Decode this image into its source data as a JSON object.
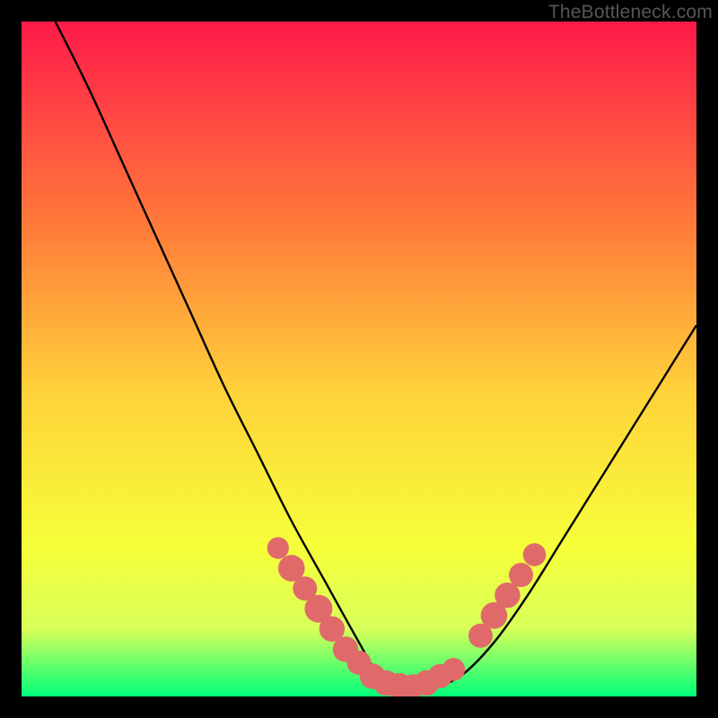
{
  "watermark": "TheBottleneck.com",
  "colors": {
    "gradient_top": "#ff1a4a",
    "gradient_mid_upper": "#ff7a3a",
    "gradient_mid": "#ffd23a",
    "gradient_mid_lower": "#f6ff3a",
    "gradient_lower": "#d8ff5a",
    "gradient_bottom": "#00ff7a",
    "curve": "#000000",
    "markers": "#e06a6a",
    "frame": "#000000"
  },
  "chart_data": {
    "type": "line",
    "title": "",
    "xlabel": "",
    "ylabel": "",
    "xlim": [
      0,
      100
    ],
    "ylim": [
      0,
      100
    ],
    "series": [
      {
        "name": "bottleneck-curve",
        "x": [
          5,
          10,
          15,
          20,
          25,
          30,
          35,
          40,
          45,
          50,
          53,
          56,
          60,
          65,
          70,
          75,
          80,
          85,
          90,
          95,
          100
        ],
        "y": [
          100,
          90,
          79,
          68,
          57,
          46,
          36,
          26,
          17,
          8,
          3,
          1,
          1,
          3,
          8,
          15,
          23,
          31,
          39,
          47,
          55
        ]
      }
    ],
    "markers": [
      {
        "x": 38,
        "y": 22,
        "r": 1.2
      },
      {
        "x": 40,
        "y": 19,
        "r": 1.6
      },
      {
        "x": 42,
        "y": 16,
        "r": 1.4
      },
      {
        "x": 44,
        "y": 13,
        "r": 1.7
      },
      {
        "x": 46,
        "y": 10,
        "r": 1.5
      },
      {
        "x": 48,
        "y": 7,
        "r": 1.5
      },
      {
        "x": 50,
        "y": 5,
        "r": 1.4
      },
      {
        "x": 52,
        "y": 3,
        "r": 1.5
      },
      {
        "x": 54,
        "y": 2,
        "r": 1.5
      },
      {
        "x": 56,
        "y": 1.5,
        "r": 1.6
      },
      {
        "x": 58,
        "y": 1.5,
        "r": 1.4
      },
      {
        "x": 60,
        "y": 2,
        "r": 1.5
      },
      {
        "x": 62,
        "y": 3,
        "r": 1.4
      },
      {
        "x": 64,
        "y": 4,
        "r": 1.3
      },
      {
        "x": 68,
        "y": 9,
        "r": 1.4
      },
      {
        "x": 70,
        "y": 12,
        "r": 1.6
      },
      {
        "x": 72,
        "y": 15,
        "r": 1.5
      },
      {
        "x": 74,
        "y": 18,
        "r": 1.4
      },
      {
        "x": 76,
        "y": 21,
        "r": 1.3
      }
    ]
  }
}
